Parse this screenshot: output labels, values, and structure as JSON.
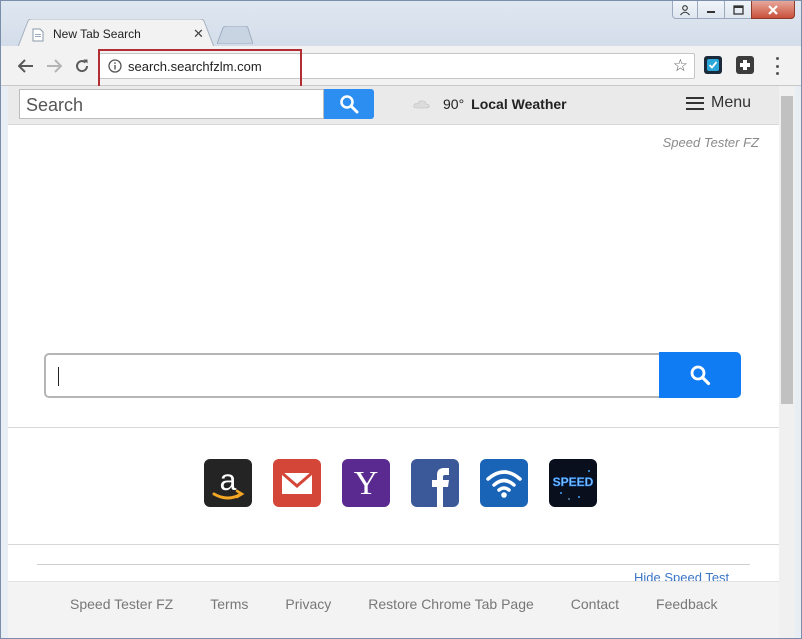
{
  "browser": {
    "tab_title": "New Tab Search",
    "tab_close": "✕",
    "url": "search.searchfzlm.com",
    "star_icon": "☆"
  },
  "topbar": {
    "search_placeholder": "Search",
    "weather_temp": "90°",
    "weather_label": "Local Weather",
    "menu_label": "Menu",
    "accent_color": "#2c8ef0"
  },
  "page": {
    "brand": "Speed Tester FZ",
    "main_search_value": "",
    "main_search_button_color": "#0f7cf4",
    "tiles": [
      {
        "name": "amazon",
        "icon": "amazon-icon"
      },
      {
        "name": "gmail",
        "icon": "mail-icon"
      },
      {
        "name": "yahoo",
        "icon": "yahoo-icon"
      },
      {
        "name": "facebook",
        "icon": "facebook-icon"
      },
      {
        "name": "wifi",
        "icon": "wifi-icon"
      },
      {
        "name": "speed",
        "icon": "speed-icon",
        "label": "SPEED"
      }
    ],
    "hide_link": "Hide Speed Test"
  },
  "footer": {
    "links": [
      "Speed Tester FZ",
      "Terms",
      "Privacy",
      "Restore Chrome Tab Page",
      "Contact",
      "Feedback"
    ]
  }
}
